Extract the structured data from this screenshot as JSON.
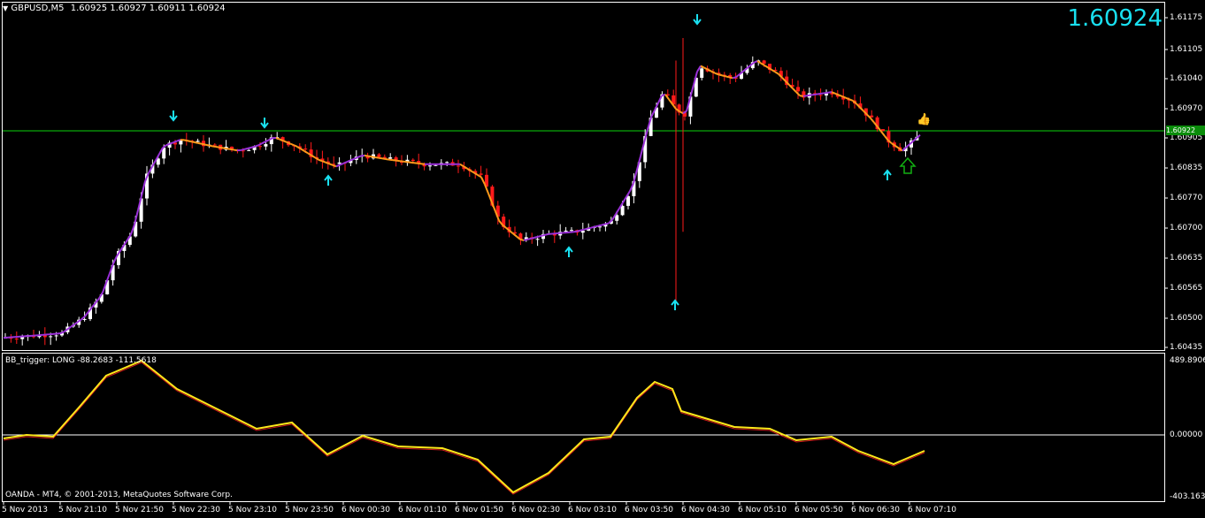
{
  "header": {
    "symbol": "GBPUSD,M5",
    "ohlc": "1.60925 1.60927 1.60911 1.60924",
    "big_price": "1.60924"
  },
  "price_axis": {
    "labels": [
      "1.61175",
      "1.61105",
      "1.61040",
      "1.60970",
      "1.60905",
      "1.60835",
      "1.60770",
      "1.60700",
      "1.60635",
      "1.60565",
      "1.60500",
      "1.60435"
    ],
    "current_price_tag": "1.60922",
    "current_price_line_value": 1.60922
  },
  "indicator": {
    "label": "BB_trigger: LONG -88.2683 -111.5618",
    "axis_labels": [
      "489.8906",
      "0.00000",
      "-403.1631"
    ]
  },
  "time_axis": {
    "labels": [
      "5 Nov 2013",
      "5 Nov 21:10",
      "5 Nov 21:50",
      "5 Nov 22:30",
      "5 Nov 23:10",
      "5 Nov 23:50",
      "6 Nov 00:30",
      "6 Nov 01:10",
      "6 Nov 01:50",
      "6 Nov 02:30",
      "6 Nov 03:10",
      "6 Nov 03:50",
      "6 Nov 04:30",
      "6 Nov 05:10",
      "6 Nov 05:50",
      "6 Nov 06:30",
      "6 Nov 07:10"
    ]
  },
  "footer": {
    "copyright": "OANDA - MT4, © 2001-2013, MetaQuotes Software Corp."
  },
  "colors": {
    "bull": "#ffffff",
    "bear": "#ff1a1a",
    "ma_up": "#9b30d9",
    "ma_down": "#ff9a1a",
    "arrow": "#19e0f0",
    "price_line": "#0aa80a",
    "osc_main": "#ffe81a",
    "osc_signal": "#d01a1a"
  },
  "icons": [
    "dropdown-triangle-icon",
    "down-arrow-signal-icon",
    "up-arrow-signal-icon",
    "green-hollow-up-arrow-icon",
    "thumbs-up-icon"
  ]
}
